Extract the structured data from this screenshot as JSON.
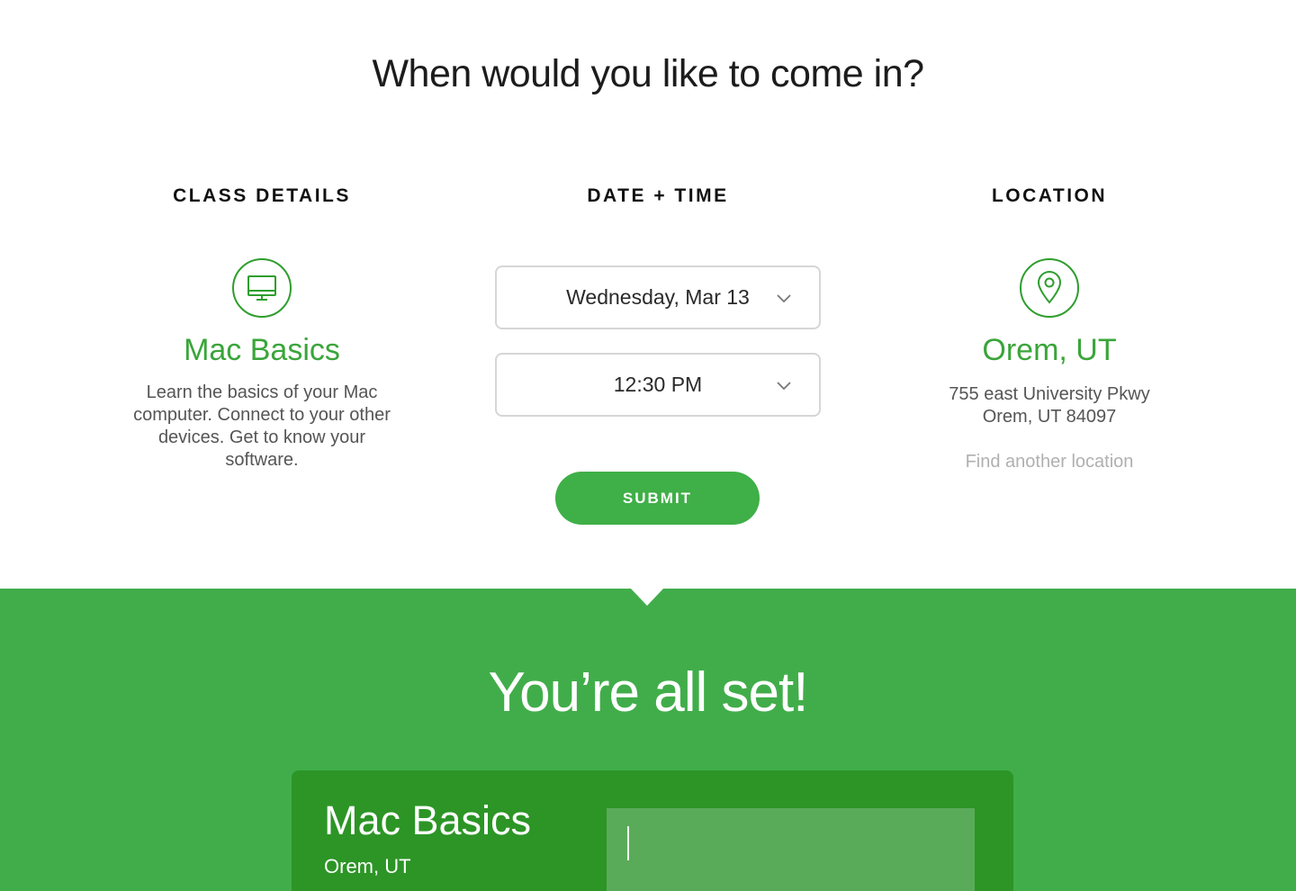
{
  "header": {
    "title": "When would you like to come in?"
  },
  "columns": {
    "class_details": {
      "heading": "CLASS DETAILS",
      "icon": "monitor-icon",
      "title": "Mac Basics",
      "description": "Learn the basics of your Mac computer. Connect to your other devices. Get to know your software."
    },
    "date_time": {
      "heading": "DATE + TIME",
      "date_value": "Wednesday, Mar 13",
      "time_value": "12:30 PM",
      "submit_label": "SUBMIT"
    },
    "location": {
      "heading": "LOCATION",
      "icon": "map-pin-icon",
      "title": "Orem, UT",
      "address_line1": "755 east University Pkwy",
      "address_line2": "Orem, UT 84097",
      "find_link": "Find another location"
    }
  },
  "confirmation": {
    "title": "You’re all set!",
    "card_title": "Mac Basics",
    "card_location": "Orem, UT"
  },
  "colors": {
    "accent_green": "#3faf47",
    "band_green": "#41ad4a",
    "card_green": "#2c9526",
    "input_green": "#5aab59"
  }
}
